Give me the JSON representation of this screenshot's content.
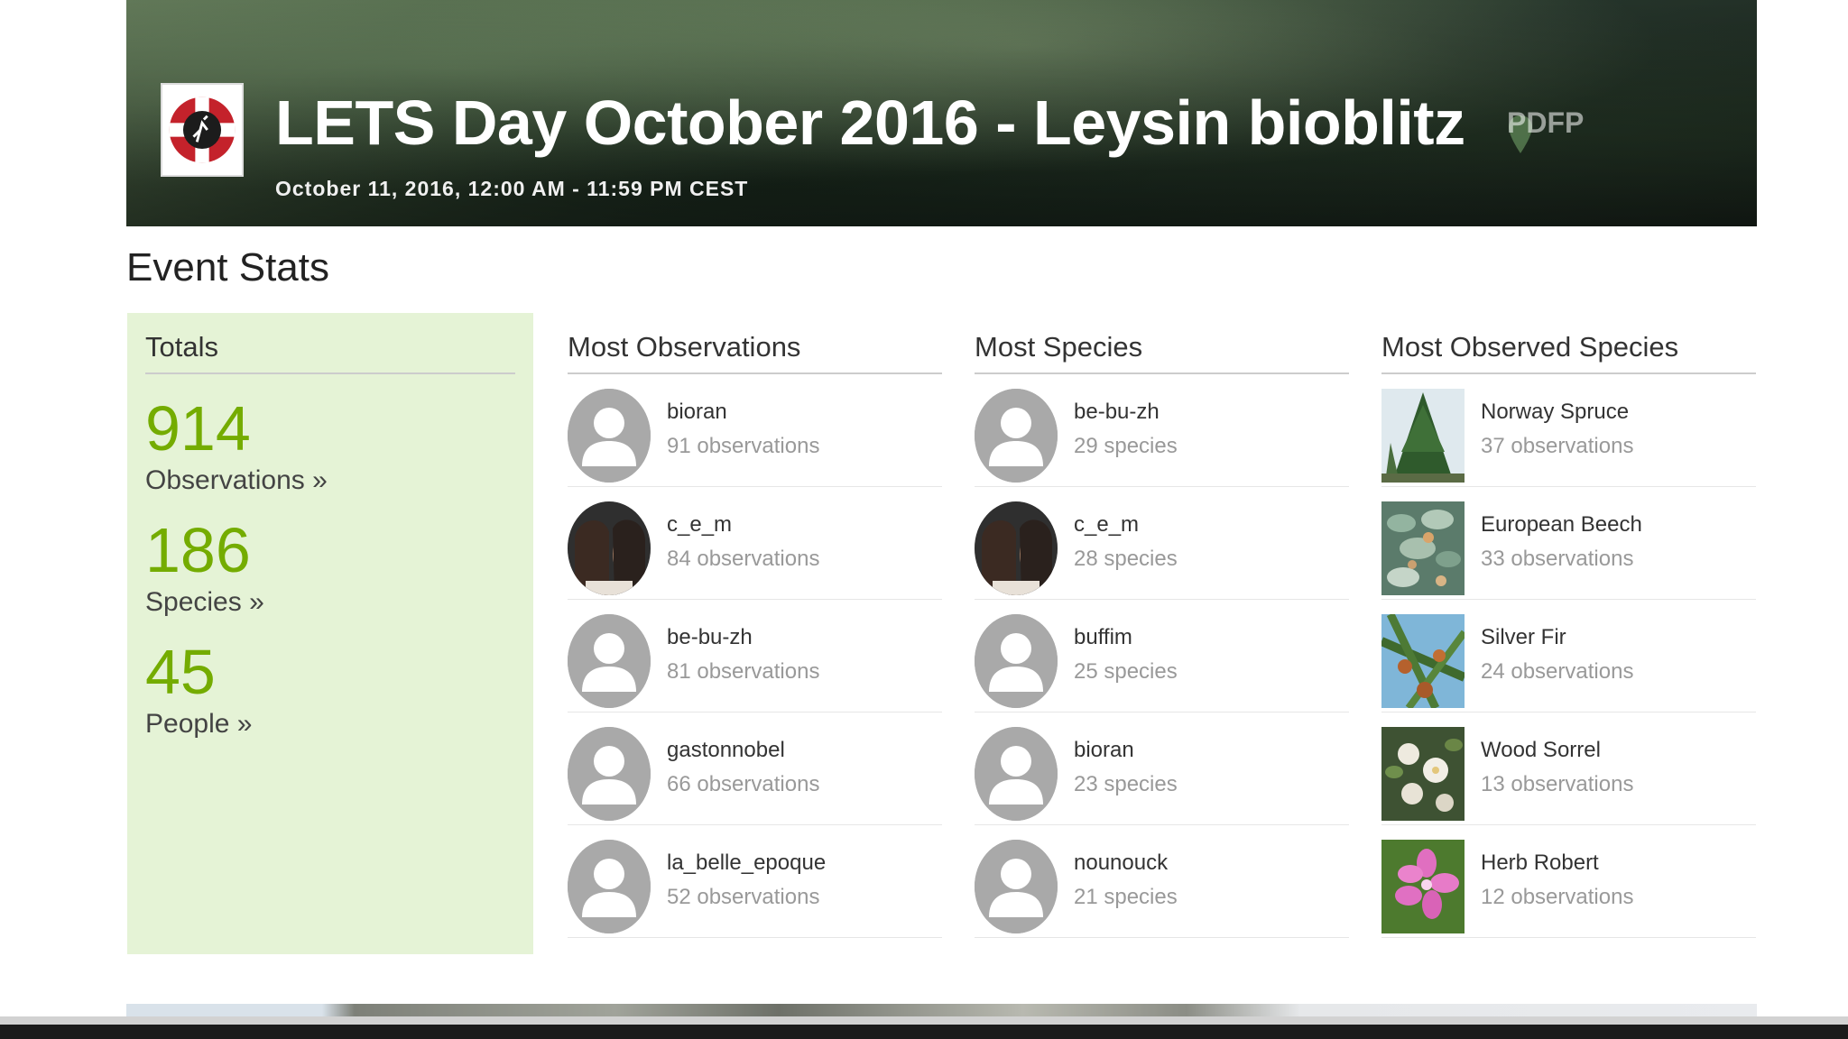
{
  "header": {
    "title": "LETS Day October 2016 - Leysin bioblitz",
    "date": "October 11, 2016, 12:00 AM - 11:59 PM CEST",
    "partner_logo_text": "PDFP"
  },
  "event_stats": {
    "title": "Event Stats",
    "totals": {
      "heading": "Totals",
      "stats": [
        {
          "value": "914",
          "label": "Observations »"
        },
        {
          "value": "186",
          "label": "Species »"
        },
        {
          "value": "45",
          "label": "People »"
        }
      ]
    },
    "most_observations": {
      "heading": "Most Observations",
      "rows": [
        {
          "name": "bioran",
          "sub": "91 observations",
          "avatar": "default"
        },
        {
          "name": "c_e_m",
          "sub": "84 observations",
          "avatar": "photo"
        },
        {
          "name": "be-bu-zh",
          "sub": "81 observations",
          "avatar": "default"
        },
        {
          "name": "gastonnobel",
          "sub": "66 observations",
          "avatar": "default"
        },
        {
          "name": "la_belle_epoque",
          "sub": "52 observations",
          "avatar": "default"
        }
      ]
    },
    "most_species": {
      "heading": "Most Species",
      "rows": [
        {
          "name": "be-bu-zh",
          "sub": "29 species",
          "avatar": "default"
        },
        {
          "name": "c_e_m",
          "sub": "28 species",
          "avatar": "photo"
        },
        {
          "name": "buffim",
          "sub": "25 species",
          "avatar": "default"
        },
        {
          "name": "bioran",
          "sub": "23 species",
          "avatar": "default"
        },
        {
          "name": "nounouck",
          "sub": "21 species",
          "avatar": "default"
        }
      ]
    },
    "most_observed_species": {
      "heading": "Most Observed Species",
      "rows": [
        {
          "name": "Norway Spruce",
          "sub": "37 observations",
          "thumb": "spruce"
        },
        {
          "name": "European Beech",
          "sub": "33 observations",
          "thumb": "beech"
        },
        {
          "name": "Silver Fir",
          "sub": "24 observations",
          "thumb": "fir"
        },
        {
          "name": "Wood Sorrel",
          "sub": "13 observations",
          "thumb": "sorrel"
        },
        {
          "name": "Herb Robert",
          "sub": "12 observations",
          "thumb": "herb-robert"
        }
      ]
    }
  },
  "colors": {
    "accent_green": "#74ac00",
    "totals_bg": "#e5f3d6"
  }
}
